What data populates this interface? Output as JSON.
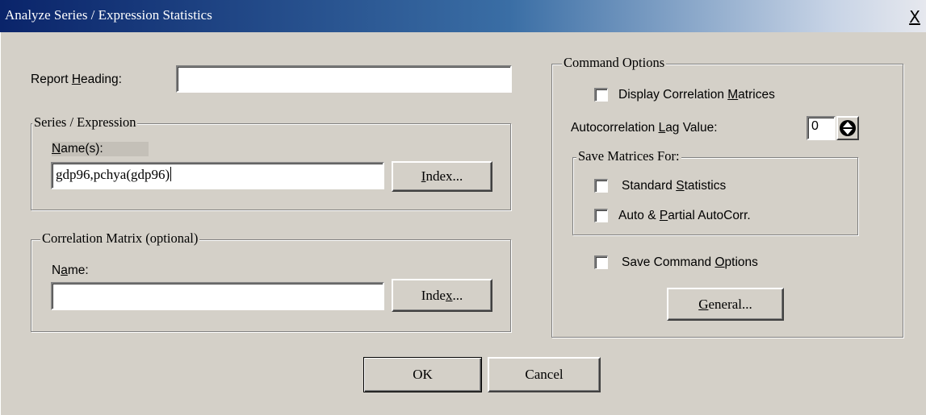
{
  "window": {
    "title": "Analyze Series / Expression Statistics",
    "close_glyph": "X"
  },
  "report_heading": {
    "label_pre": "Report ",
    "label_key": "H",
    "label_post": "eading:",
    "value": ""
  },
  "series_group": {
    "title": "Series / Expression",
    "names_label_key": "N",
    "names_label_post": "ame(s):",
    "names_value": "gdp96,pchya(gdp96)",
    "index_key": "I",
    "index_post": "ndex..."
  },
  "corr_group": {
    "title": "Correlation Matrix (optional)",
    "name_label_pre": "N",
    "name_label_key": "a",
    "name_label_post": "me:",
    "name_value": "",
    "index_pre": "Inde",
    "index_key": "x",
    "index_post": "..."
  },
  "command_options": {
    "title": "Command Options",
    "display_corr": {
      "pre": "Display Correlation ",
      "key": "M",
      "post": "atrices",
      "checked": false
    },
    "lag": {
      "pre": "Autocorrelation ",
      "key": "L",
      "post": "ag Value:",
      "value": "0"
    },
    "save_matrices": {
      "title": "Save Matrices For:",
      "standard": {
        "pre": "Standard ",
        "key": "S",
        "post": "tatistics",
        "checked": false
      },
      "autopartial": {
        "pre": "Auto & ",
        "key": "P",
        "post": "artial AutoCorr.",
        "checked": false
      }
    },
    "save_command": {
      "pre": "Save Command ",
      "key": "O",
      "post": "ptions",
      "checked": false
    },
    "general": {
      "key": "G",
      "post": "eneral..."
    }
  },
  "buttons": {
    "ok": "OK",
    "cancel": "Cancel"
  },
  "colors": {
    "face": "#d4d0c8",
    "title_start": "#0a246a",
    "title_end": "#e6e8ee"
  }
}
